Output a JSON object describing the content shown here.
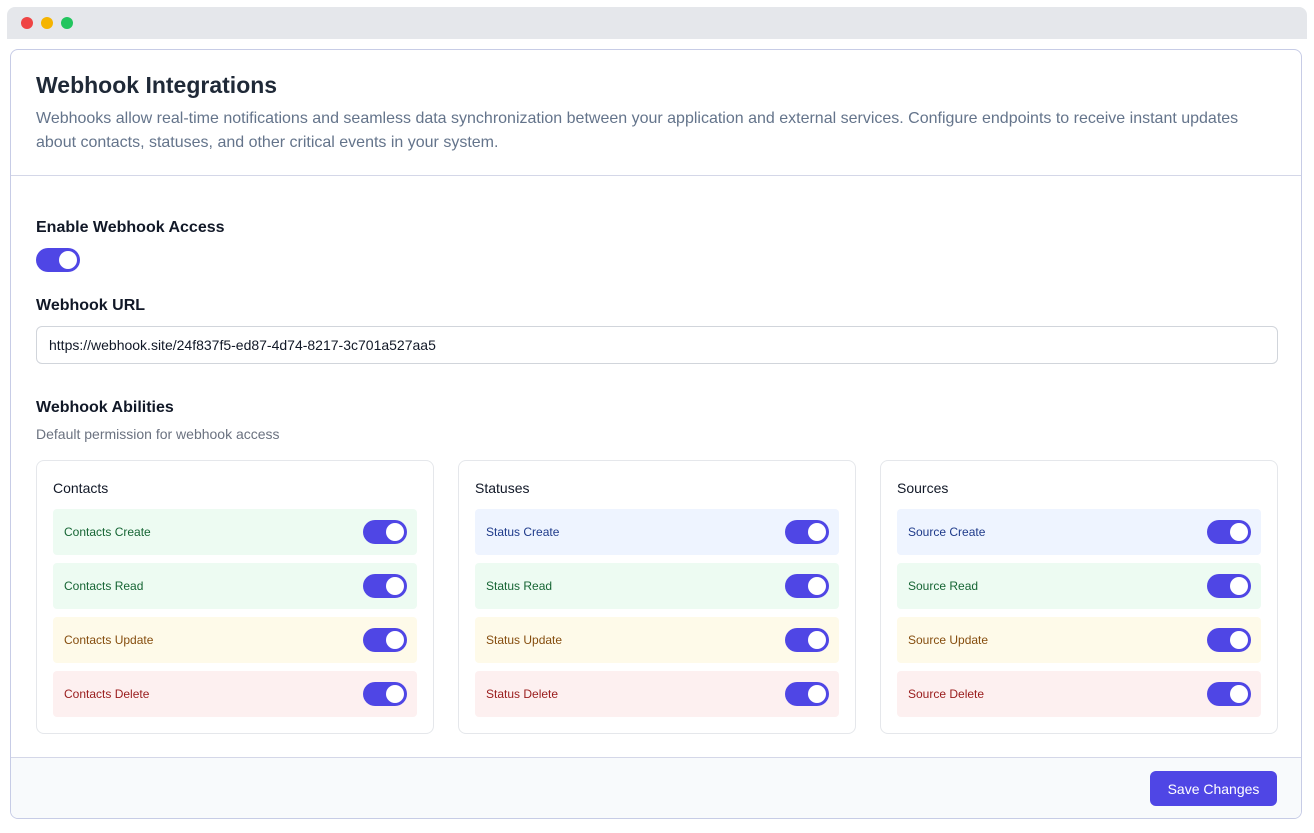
{
  "header": {
    "title": "Webhook Integrations",
    "description": "Webhooks allow real-time notifications and seamless data synchronization between your application and external services. Configure endpoints to receive instant updates about contacts, statuses, and other critical events in your system."
  },
  "enable_access": {
    "label": "Enable Webhook Access",
    "enabled": true
  },
  "url": {
    "label": "Webhook URL",
    "value": "https://webhook.site/24f837f5-ed87-4d74-8217-3c701a527aa5"
  },
  "abilities": {
    "title": "Webhook Abilities",
    "subtitle": "Default permission for webhook access",
    "groups": [
      {
        "title": "Contacts",
        "items": [
          {
            "label": "Contacts Create",
            "enabled": true,
            "color": "green"
          },
          {
            "label": "Contacts Read",
            "enabled": true,
            "color": "green"
          },
          {
            "label": "Contacts Update",
            "enabled": true,
            "color": "yellow"
          },
          {
            "label": "Contacts Delete",
            "enabled": true,
            "color": "red"
          }
        ]
      },
      {
        "title": "Statuses",
        "items": [
          {
            "label": "Status Create",
            "enabled": true,
            "color": "blue"
          },
          {
            "label": "Status Read",
            "enabled": true,
            "color": "green"
          },
          {
            "label": "Status Update",
            "enabled": true,
            "color": "yellow"
          },
          {
            "label": "Status Delete",
            "enabled": true,
            "color": "red"
          }
        ]
      },
      {
        "title": "Sources",
        "items": [
          {
            "label": "Source Create",
            "enabled": true,
            "color": "blue"
          },
          {
            "label": "Source Read",
            "enabled": true,
            "color": "green"
          },
          {
            "label": "Source Update",
            "enabled": true,
            "color": "yellow"
          },
          {
            "label": "Source Delete",
            "enabled": true,
            "color": "red"
          }
        ]
      }
    ]
  },
  "footer": {
    "save_label": "Save Changes"
  },
  "colors": {
    "accent": "#4f46e5"
  }
}
